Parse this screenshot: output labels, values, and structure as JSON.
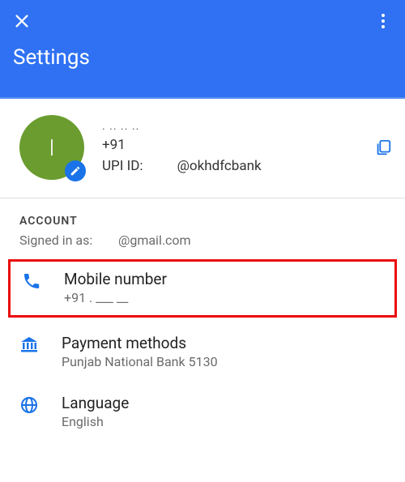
{
  "header": {
    "title": "Settings"
  },
  "profile": {
    "initial": "I",
    "line1": ". .. .. ..",
    "phone": "+91",
    "upi_label": "UPI ID:",
    "upi_handle": "@okhdfcbank"
  },
  "account": {
    "section_label": "ACCOUNT",
    "signed_in_label": "Signed in as:",
    "signed_in_email": "@gmail.com"
  },
  "items": {
    "mobile": {
      "title": "Mobile number",
      "sub": "+91 . ___ __"
    },
    "payment": {
      "title": "Payment methods",
      "sub": "Punjab National Bank 5130"
    },
    "language": {
      "title": "Language",
      "sub": "English"
    }
  }
}
